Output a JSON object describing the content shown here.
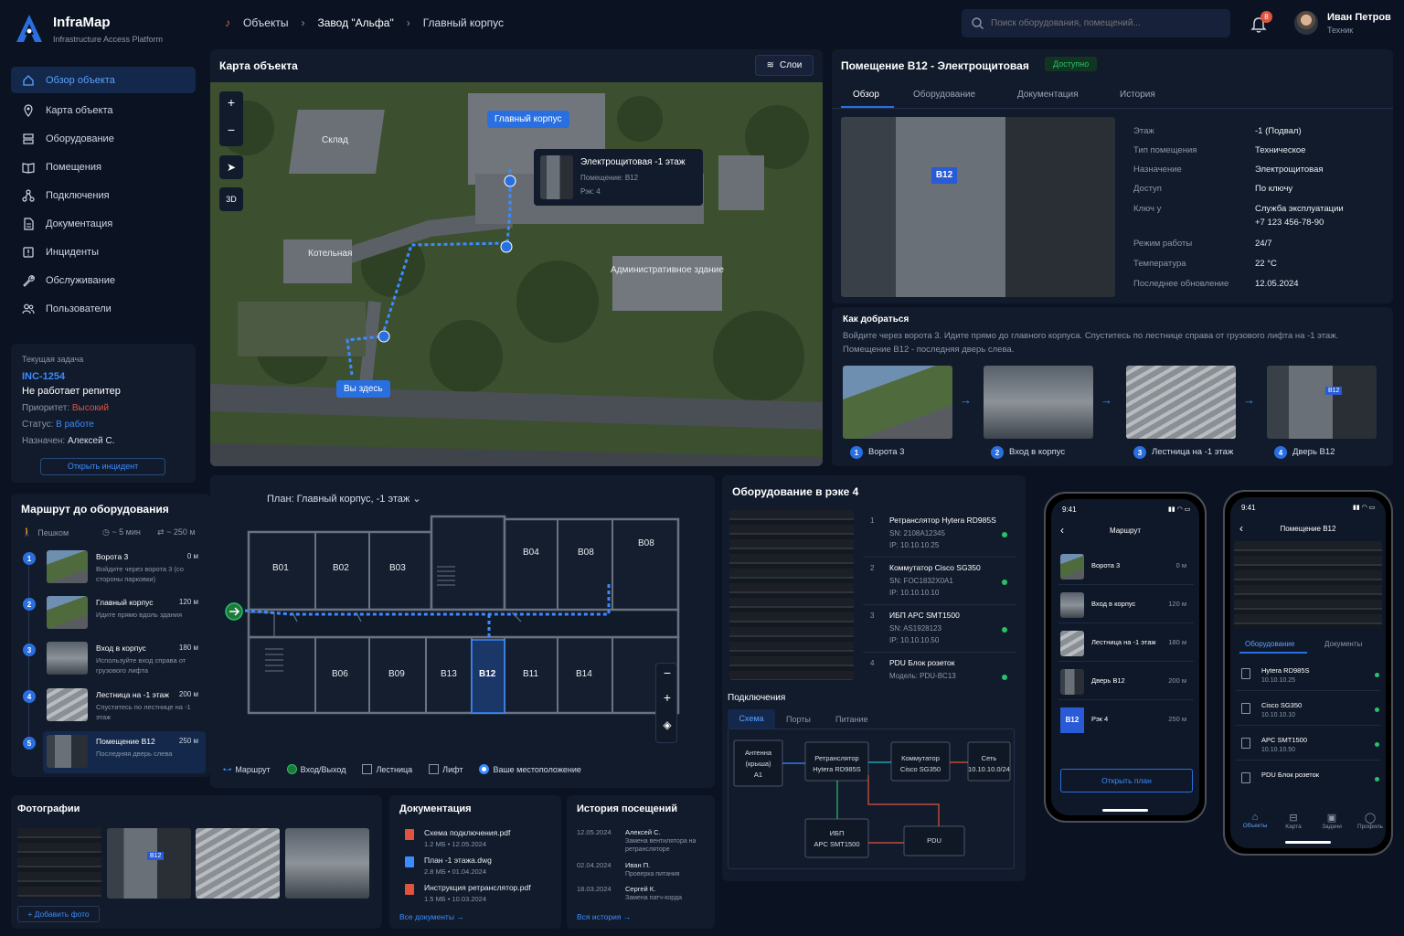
{
  "app": {
    "name": "InfraMap",
    "subtitle": "Infrastructure Access Platform"
  },
  "breadcrumb": [
    "Объекты",
    "Завод \"Альфа\"",
    "Главный корпус"
  ],
  "search": {
    "placeholder": "Поиск оборудования, помещений..."
  },
  "notifications": {
    "count": "8"
  },
  "user": {
    "name": "Иван Петров",
    "role": "Техник"
  },
  "nav": [
    "Обзор объекта",
    "Карта объекта",
    "Оборудование",
    "Помещения",
    "Подключения",
    "Документация",
    "Инциденты",
    "Обслуживание",
    "Пользователи"
  ],
  "task": {
    "heading": "Текущая задача",
    "id": "INC-1254",
    "title": "Не работает репитер",
    "priority_label": "Приоритет:",
    "priority": "Высокий",
    "status_label": "Статус:",
    "status": "В работе",
    "assignee_label": "Назначен:",
    "assignee": "Алексей С.",
    "button": "Открыть инцидент"
  },
  "route": {
    "title": "Маршрут до оборудования",
    "mode": "Пешком",
    "time": "~ 5 мин",
    "distance": "~ 250 м",
    "steps": [
      {
        "n": "1",
        "title": "Ворота 3",
        "dist": "0 м",
        "desc": "Войдите через ворота 3 (со стороны парковки)"
      },
      {
        "n": "2",
        "title": "Главный корпус",
        "dist": "120 м",
        "desc": "Идите прямо вдоль здания"
      },
      {
        "n": "3",
        "title": "Вход в корпус",
        "dist": "180 м",
        "desc": "Используйте вход справа от грузового лифта"
      },
      {
        "n": "4",
        "title": "Лестница на -1 этаж",
        "dist": "200 м",
        "desc": "Спуститесь по лестнице на -1 этаж"
      },
      {
        "n": "5",
        "title": "Помещение B12",
        "dist": "250 м",
        "desc": "Последняя дверь слева"
      }
    ]
  },
  "map": {
    "title": "Карта объекта",
    "layers": "Слои",
    "mode3d": "3D",
    "labels": {
      "sklad": "Склад",
      "main": "Главный корпус",
      "boiler": "Котельная",
      "admin": "Административное здание",
      "here": "Вы здесь"
    },
    "popup": {
      "title": "Электрощитовая -1 этаж",
      "room": "Помещение: B12",
      "rack": "Рэк: 4"
    }
  },
  "room": {
    "title": "Помещение B12 - Электрощитовая",
    "status": "Доступно",
    "door_label": "B12",
    "tabs": [
      "Обзор",
      "Оборудование",
      "Документация",
      "История"
    ],
    "props": [
      {
        "k": "Этаж",
        "v": "-1 (Подвал)"
      },
      {
        "k": "Тип помещения",
        "v": "Техническое"
      },
      {
        "k": "Назначение",
        "v": "Электрощитовая"
      },
      {
        "k": "Доступ",
        "v": "По ключу"
      },
      {
        "k": "Ключ у",
        "v": "Служба эксплуатации",
        "v2": "+7 123 456-78-90"
      },
      {
        "k": "Режим работы",
        "v": "24/7"
      },
      {
        "k": "Температура",
        "v": "22 °C"
      },
      {
        "k": "Последнее обновление",
        "v": "12.05.2024"
      }
    ]
  },
  "how": {
    "title": "Как добраться",
    "text1": "Войдите через ворота 3. Идите прямо до главного корпуса. Спуститесь по лестнице справа от грузового лифта на -1 этаж.",
    "text2": "Помещение B12 - последняя дверь слева.",
    "steps": [
      {
        "n": "1",
        "label": "Ворота 3"
      },
      {
        "n": "2",
        "label": "Вход в корпус"
      },
      {
        "n": "3",
        "label": "Лестница на -1 этаж"
      },
      {
        "n": "4",
        "label": "Дверь B12"
      }
    ],
    "door_label": "B12"
  },
  "plan": {
    "title": "План: Главный корпус, -1 этаж",
    "rooms_top": [
      "B01",
      "B02",
      "B03",
      "B04",
      "B08",
      "B08"
    ],
    "rooms_bottom": [
      "B06",
      "B09",
      "B13",
      "B12",
      "B11",
      "B14"
    ],
    "legend": [
      "Маршрут",
      "Вход/Выход",
      "Лестница",
      "Лифт",
      "Ваше местоположение"
    ]
  },
  "rack": {
    "title": "Оборудование в рэке 4",
    "items": [
      {
        "n": "1",
        "name": "Ретранслятор Hytera RD985S",
        "l1": "SN: 2108A12345",
        "l2": "IP: 10.10.10.25"
      },
      {
        "n": "2",
        "name": "Коммутатор Cisco SG350",
        "l1": "SN: FOC1832X0A1",
        "l2": "IP: 10.10.10.10"
      },
      {
        "n": "3",
        "name": "ИБП APC SMT1500",
        "l1": "SN: AS1928123",
        "l2": "IP: 10.10.10.50"
      },
      {
        "n": "4",
        "name": "PDU Блок розеток",
        "l1": "Модель: PDU-BC13",
        "l2": ""
      }
    ]
  },
  "conn": {
    "title": "Подключения",
    "tabs": [
      "Схема",
      "Порты",
      "Питание"
    ],
    "nodes": {
      "ant1": "Антенна",
      "ant2": "(крыша)",
      "ant3": "A1",
      "rep1": "Ретранслятор",
      "rep2": "Hytera RD985S",
      "sw1": "Коммутатор",
      "sw2": "Cisco SG350",
      "net1": "Сеть",
      "net2": "10.10.10.0/24",
      "ups1": "ИБП",
      "ups2": "APC SMT1500",
      "pdu": "PDU"
    }
  },
  "photos": {
    "title": "Фотографии",
    "add": "+ Добавить фото",
    "badge": "B12"
  },
  "docs": {
    "title": "Документация",
    "items": [
      {
        "name": "Схема подключения.pdf",
        "meta": "1.2 МБ  •  12.05.2024",
        "color": "#e0533d"
      },
      {
        "name": "План -1 этажа.dwg",
        "meta": "2.8 МБ  •  01.04.2024",
        "color": "#3b8cff"
      },
      {
        "name": "Инструкция ретранслятор.pdf",
        "meta": "1.5 МБ  •  10.03.2024",
        "color": "#e0533d"
      }
    ],
    "all": "Все документы →"
  },
  "history": {
    "title": "История посещений",
    "items": [
      {
        "date": "12.05.2024",
        "who": "Алексей С.",
        "what": "Замена вентилятора на ретрансляторе"
      },
      {
        "date": "02.04.2024",
        "who": "Иван П.",
        "what": "Проверка питания"
      },
      {
        "date": "18.03.2024",
        "who": "Сергей К.",
        "what": "Замена патч-корда"
      }
    ],
    "all": "Вся история →"
  },
  "phone1": {
    "time": "9:41",
    "title": "Маршрут",
    "rows": [
      {
        "label": "Ворота 3",
        "dist": "0 м"
      },
      {
        "label": "Вход в корпус",
        "dist": "120 м"
      },
      {
        "label": "Лестница на -1 этаж",
        "dist": "180 м"
      },
      {
        "label": "Дверь B12",
        "dist": "200 м"
      },
      {
        "label": "Рэк 4",
        "dist": "250 м"
      }
    ],
    "badge": "B12",
    "button": "Открыть план"
  },
  "phone2": {
    "time": "9:41",
    "title": "Помещение B12",
    "tabs": [
      "Оборудование",
      "Документы"
    ],
    "rows": [
      {
        "name": "Hytera RD985S",
        "ip": "10.10.10.25"
      },
      {
        "name": "Cisco SG350",
        "ip": "10.10.10.10"
      },
      {
        "name": "APC SMT1500",
        "ip": "10.10.10.50"
      },
      {
        "name": "PDU Блок розеток",
        "ip": ""
      }
    ],
    "nav": [
      "Объекты",
      "Карта",
      "Задачи",
      "Профиль"
    ]
  },
  "colors": {
    "accent": "#2a6fe0",
    "danger": "#e0533d",
    "ok": "#26c26a"
  }
}
